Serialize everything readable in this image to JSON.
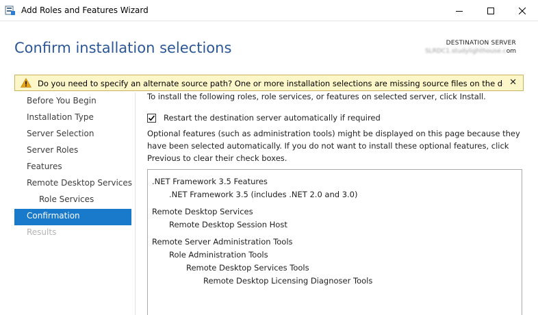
{
  "window": {
    "title": "Add Roles and Features Wizard"
  },
  "header": {
    "page_title": "Confirm installation selections",
    "dest_label": "DESTINATION SERVER",
    "dest_value_hidden": "SLRDC1.studylighthouse.c",
    "dest_value_suffix": "om"
  },
  "warning": {
    "text": "Do you need to specify an alternate source path? One or more installation selections are missing source files on the destinati...",
    "close_glyph": "✕"
  },
  "nav": {
    "items": [
      {
        "label": "Before You Begin",
        "state": "normal",
        "level": 0
      },
      {
        "label": "Installation Type",
        "state": "normal",
        "level": 0
      },
      {
        "label": "Server Selection",
        "state": "normal",
        "level": 0
      },
      {
        "label": "Server Roles",
        "state": "normal",
        "level": 0
      },
      {
        "label": "Features",
        "state": "normal",
        "level": 0
      },
      {
        "label": "Remote Desktop Services",
        "state": "normal",
        "level": 0
      },
      {
        "label": "Role Services",
        "state": "normal",
        "level": 1
      },
      {
        "label": "Confirmation",
        "state": "active",
        "level": 0
      },
      {
        "label": "Results",
        "state": "disabled",
        "level": 0
      }
    ]
  },
  "content": {
    "intro": "To install the following roles, role services, or features on selected server, click Install.",
    "restart_label": "Restart the destination server automatically if required",
    "restart_checked": true,
    "optional_text": "Optional features (such as administration tools) might be displayed on this page because they have been selected automatically. If you do not want to install these optional features, click Previous to clear their check boxes.",
    "selections": [
      {
        "label": ".NET Framework 3.5 Features",
        "level": 0
      },
      {
        "label": ".NET Framework 3.5 (includes .NET 2.0 and 3.0)",
        "level": 1
      },
      {
        "label": "Remote Desktop Services",
        "level": 0
      },
      {
        "label": "Remote Desktop Session Host",
        "level": 1
      },
      {
        "label": "Remote Server Administration Tools",
        "level": 0
      },
      {
        "label": "Role Administration Tools",
        "level": 1
      },
      {
        "label": "Remote Desktop Services Tools",
        "level": 2
      },
      {
        "label": "Remote Desktop Licensing Diagnoser Tools",
        "level": 3
      }
    ]
  },
  "colors": {
    "title_blue": "#2b5797",
    "nav_active": "#1979ca",
    "warning_bg": "#fcf6c8",
    "warning_icon": "#e8a317"
  }
}
